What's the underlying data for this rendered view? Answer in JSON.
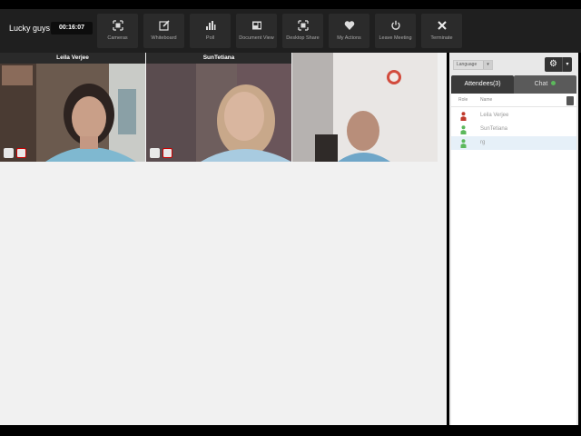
{
  "header": {
    "meeting_title": "Lucky guys",
    "timer": "00:16:07",
    "buttons": [
      {
        "label": "Cameras",
        "icon": "cameras-icon"
      },
      {
        "label": "Whiteboard",
        "icon": "whiteboard-icon"
      },
      {
        "label": "Poll",
        "icon": "poll-icon"
      },
      {
        "label": "Document View",
        "icon": "document-view-icon"
      },
      {
        "label": "Desktop Share",
        "icon": "desktop-share-icon"
      },
      {
        "label": "My Actions",
        "icon": "heart-icon"
      },
      {
        "label": "Leave Meeting",
        "icon": "power-icon"
      },
      {
        "label": "Terminate",
        "icon": "close-icon"
      }
    ]
  },
  "videos": [
    {
      "name": "Leila Verjee"
    },
    {
      "name": "SunTetiana"
    },
    {
      "name": ""
    }
  ],
  "panel": {
    "language_label": "Language",
    "tabs": {
      "attendees": "Attendees(3)",
      "chat": "Chat"
    },
    "list_header": {
      "role": "Role",
      "name": "Name"
    },
    "attendees": [
      {
        "name": "Leila Verjee",
        "role_color": "#c0392b"
      },
      {
        "name": "SunTetiana",
        "role_color": "#5cb85c"
      },
      {
        "name": "rg",
        "role_color": "#5cb85c"
      }
    ]
  },
  "colors": {
    "toolbar_bg": "#1f1f1f",
    "button_bg": "#2b2b2b",
    "main_bg": "#f1f1f1",
    "selected_row": "#e6f0f8"
  }
}
